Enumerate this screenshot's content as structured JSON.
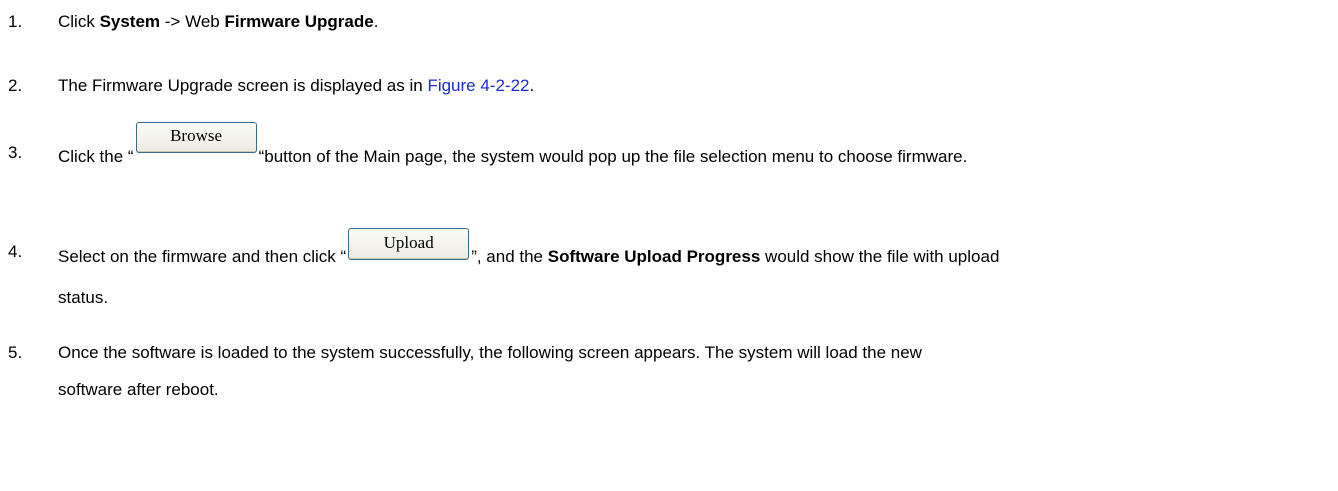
{
  "steps": [
    {
      "num": "1.",
      "pre": "Click ",
      "bold1": "System",
      "mid": " -> Web ",
      "bold2": "Firmware Upgrade",
      "post": "."
    },
    {
      "num": "2.",
      "pre": "The Firmware Upgrade screen is displayed as in ",
      "link": "Figure 4-2-22",
      "post": "."
    },
    {
      "num": "3.",
      "pre": "Click the “",
      "button": "Browse",
      "post": "“button of the Main page, the system would pop up the file selection menu to choose firmware."
    },
    {
      "num": "4.",
      "pre": "Select on the firmware and then click “",
      "button": "Upload",
      "mid": "”, and the ",
      "bold": "Software Upload Progress",
      "post": " would show the file with upload",
      "line2": "status."
    },
    {
      "num": "5.",
      "line1": "Once the software is loaded to the system successfully, the following screen appears. The system will load the new",
      "line2": "software after reboot."
    }
  ]
}
